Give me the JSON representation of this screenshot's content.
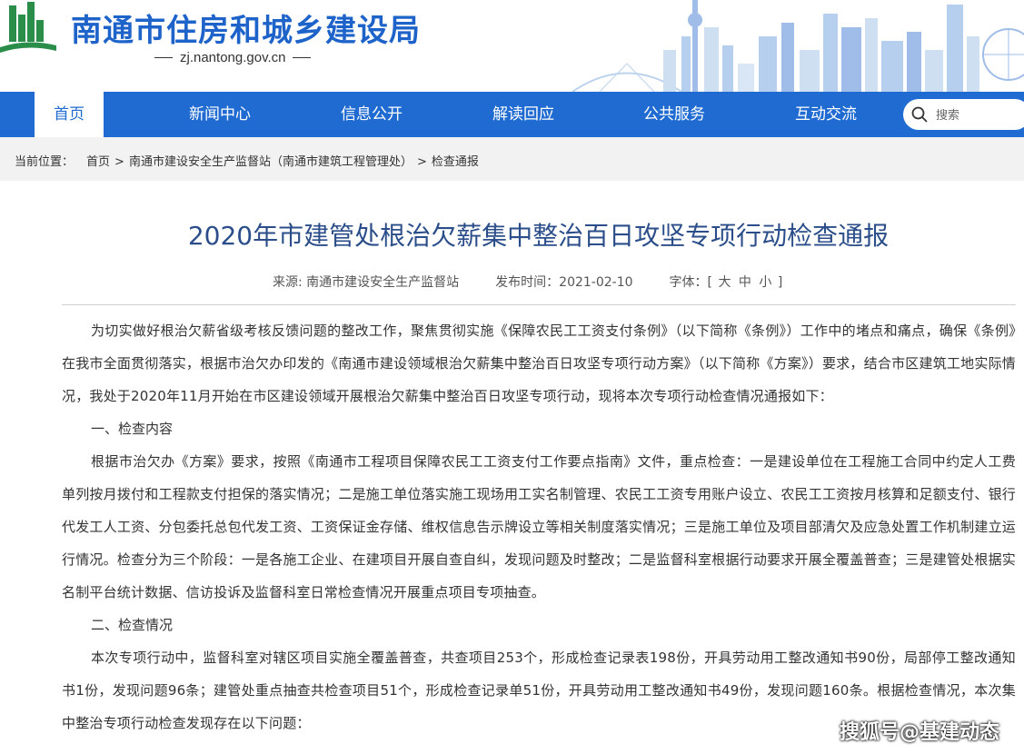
{
  "header": {
    "site_title": "南通市住房和城乡建设局",
    "site_url": "zj.nantong.gov.cn"
  },
  "nav": {
    "items": [
      "首页",
      "新闻中心",
      "信息公开",
      "解读回应",
      "公共服务",
      "互动交流"
    ],
    "active": "首页",
    "search_placeholder": "搜索"
  },
  "breadcrumb": {
    "label": "当前位置：",
    "items": [
      "首页",
      "南通市建设安全生产监督站（南通市建筑工程管理处）",
      "检查通报"
    ],
    "separator": ">"
  },
  "article": {
    "title": "2020年市建管处根治欠薪集中整治百日攻坚专项行动检查通报",
    "source": "来源: 南通市建设安全生产监督站",
    "date": "发布时间：2021-02-10",
    "font_label": "字体：",
    "font_open": "[",
    "font_large": "大",
    "font_medium": "中",
    "font_small": "小",
    "font_close": "]",
    "p1": "为切实做好根治欠薪省级考核反馈问题的整改工作，聚焦贯彻实施《保障农民工工资支付条例》（以下简称《条例》）工作中的堵点和痛点，确保《条例》在我市全面贯彻落实，根据市治欠办印发的《南通市建设领域根治欠薪集中整治百日攻坚专项行动方案》（以下简称《方案》）要求，结合市区建筑工地实际情况，我处于2020年11月开始在市区建设领域开展根治欠薪集中整治百日攻坚专项行动，现将本次专项行动检查情况通报如下：",
    "h1": "一、检查内容",
    "p2": "根据市治欠办《方案》要求，按照《南通市工程项目保障农民工工资支付工作要点指南》文件，重点检查：一是建设单位在工程施工合同中约定人工费单列按月拨付和工程款支付担保的落实情况；二是施工单位落实施工现场用工实名制管理、农民工工资专用账户设立、农民工工资按月核算和足额支付、银行代发工人工资、分包委托总包代发工资、工资保证金存储、维权信息告示牌设立等相关制度落实情况；三是施工单位及项目部清欠及应急处置工作机制建立运行情况。检查分为三个阶段：一是各施工企业、在建项目开展自查自纠，发现问题及时整改；二是监督科室根据行动要求开展全覆盖普查；三是建管处根据实名制平台统计数据、信访投诉及监督科室日常检查情况开展重点项目专项抽查。",
    "h2": "二、检查情况",
    "p3": "本次专项行动中，监督科室对辖区项目实施全覆盖普查，共查项目253个，形成检查记录表198份，开具劳动用工整改通知书90份，局部停工整改通知书1份，发现问题96条；建管处重点抽查共检查项目51个，形成检查记录单51份，开具劳动用工整改通知书49份，发现问题160条。根据检查情况，本次集中整治专项行动检查发现存在以下问题："
  },
  "watermark": "搜狐号@基建动态",
  "colors": {
    "nav_bg": "#1f6bd1",
    "title_blue": "#1e63c9",
    "article_title": "#2b4e8a"
  }
}
